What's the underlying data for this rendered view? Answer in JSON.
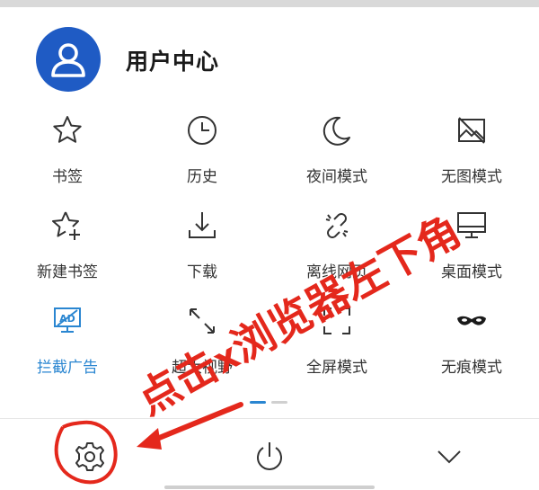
{
  "header": {
    "title": "用户中心",
    "avatar_icon": "user-avatar-icon"
  },
  "menu": {
    "items": [
      {
        "label": "书签",
        "icon": "star-icon"
      },
      {
        "label": "历史",
        "icon": "clock-icon"
      },
      {
        "label": "夜间模式",
        "icon": "moon-icon"
      },
      {
        "label": "无图模式",
        "icon": "no-image-icon"
      },
      {
        "label": "新建书签",
        "icon": "star-plus-icon"
      },
      {
        "label": "下载",
        "icon": "download-icon"
      },
      {
        "label": "离线网页",
        "icon": "offline-link-icon"
      },
      {
        "label": "桌面模式",
        "icon": "desktop-icon"
      },
      {
        "label": "拦截广告",
        "icon": "ad-block-icon",
        "active": true
      },
      {
        "label": "超大视野",
        "icon": "expand-icon"
      },
      {
        "label": "全屏模式",
        "icon": "fullscreen-icon"
      },
      {
        "label": "无痕模式",
        "icon": "mask-icon"
      }
    ]
  },
  "pager": {
    "current": 1,
    "total": 2
  },
  "bottom_bar": {
    "buttons": [
      {
        "icon": "gear-icon"
      },
      {
        "icon": "power-icon"
      },
      {
        "icon": "chevron-down-icon"
      }
    ]
  },
  "annotation": {
    "text_part1": "点击",
    "text_x": "x",
    "text_part2": "浏览器左下角",
    "color": "#e4281c"
  },
  "colors": {
    "accent": "#2a86d1",
    "avatar_bg": "#1f5bc4",
    "annotation": "#e4281c"
  }
}
